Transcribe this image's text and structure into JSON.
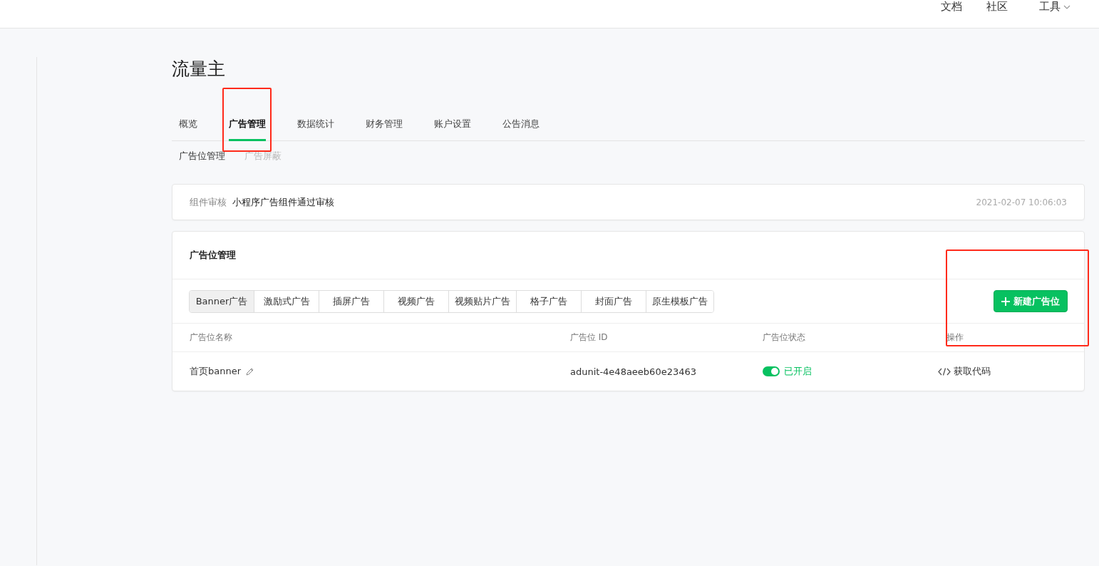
{
  "top_nav": {
    "links": [
      "文档",
      "社区"
    ],
    "menu": "工具"
  },
  "page_title": "流量主",
  "tabs": [
    {
      "label": "概览",
      "selected": false,
      "highlighted": false
    },
    {
      "label": "广告管理",
      "selected": true,
      "highlighted": true
    },
    {
      "label": "数据统计",
      "selected": false,
      "highlighted": false
    },
    {
      "label": "财务管理",
      "selected": false,
      "highlighted": false
    },
    {
      "label": "账户设置",
      "selected": false,
      "highlighted": false
    },
    {
      "label": "公告消息",
      "selected": false,
      "highlighted": false
    }
  ],
  "sub_tabs": [
    {
      "label": "广告位管理",
      "disabled": false
    },
    {
      "label": "广告屏蔽",
      "disabled": true
    }
  ],
  "notice": {
    "label": "组件审核",
    "message": "小程序广告组件通过审核",
    "time": "2021-02-07 10:06:03"
  },
  "panel": {
    "title": "广告位管理",
    "ad_types": [
      {
        "label": "Banner广告",
        "selected": true
      },
      {
        "label": "激励式广告",
        "selected": false
      },
      {
        "label": "插屏广告",
        "selected": false
      },
      {
        "label": "视频广告",
        "selected": false
      },
      {
        "label": "视频贴片广告",
        "selected": false
      },
      {
        "label": "格子广告",
        "selected": false
      },
      {
        "label": "封面广告",
        "selected": false
      },
      {
        "label": "原生模板广告",
        "selected": false
      }
    ],
    "new_button": {
      "label": "新建广告位",
      "highlighted": true
    },
    "columns": [
      "广告位名称",
      "广告位 ID",
      "广告位状态",
      "操作"
    ],
    "rows": [
      {
        "name": "首页banner",
        "id": "adunit-4e48aeeb60e23463",
        "on": true,
        "status": "已开启",
        "action": "获取代码"
      }
    ]
  }
}
